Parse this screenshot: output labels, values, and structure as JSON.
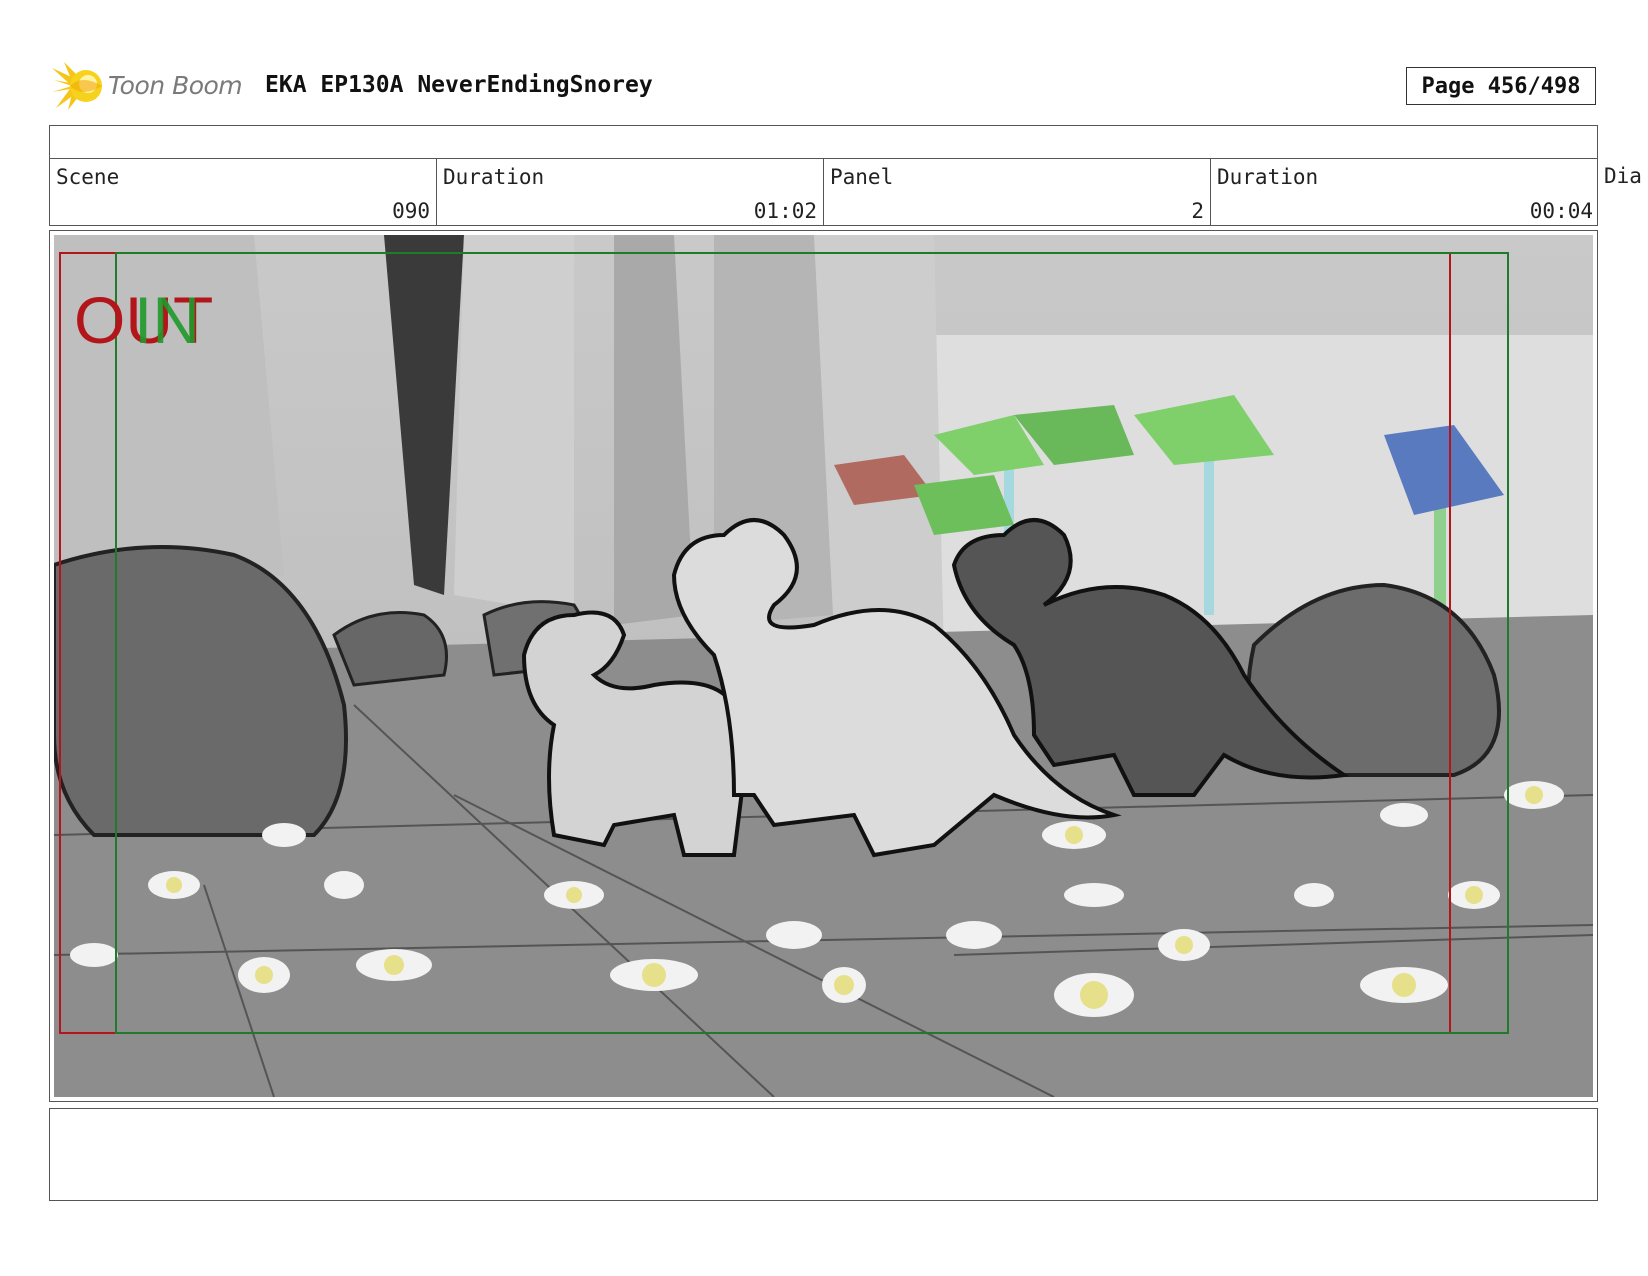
{
  "header": {
    "brand": "Toon Boom",
    "title": "EKA EP130A NeverEndingSnorey",
    "page": "Page 456/498"
  },
  "info": {
    "scene_label": "Scene",
    "scene_value": "090",
    "duration_label": "Duration",
    "duration_value": "01:02",
    "panel_label": "Panel",
    "panel_value": "2",
    "panel_duration_label": "Duration",
    "panel_duration_value": "00:04",
    "dialog_label": "Dia"
  },
  "panel": {
    "out_text": "OUT",
    "in_text": "IN",
    "frame_colors": {
      "out": "#b3161a",
      "in": "#1f7a2a"
    }
  },
  "icons": {
    "logo": "toon-boom-sun-logo"
  }
}
